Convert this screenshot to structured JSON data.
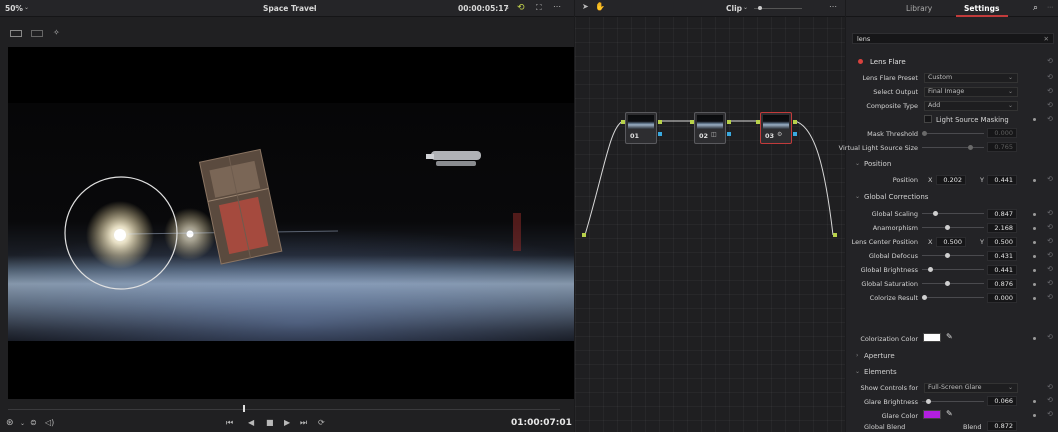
{
  "viewer": {
    "zoom": "50%",
    "title": "Space Travel",
    "timecode": "00:00:05:17",
    "bottom_timecode": "01:00:07:01"
  },
  "node_editor": {
    "mode": "Clip",
    "nodes": [
      {
        "label": "01"
      },
      {
        "label": "02"
      },
      {
        "label": "03"
      }
    ]
  },
  "inspector": {
    "tabs": [
      "Library",
      "Settings"
    ],
    "active_tab": "Settings",
    "search_value": "lens",
    "effect_name": "Lens Flare",
    "rows": {
      "preset_label": "Lens Flare Preset",
      "preset_value": "Custom",
      "output_label": "Select Output",
      "output_value": "Final Image",
      "composite_label": "Composite Type",
      "composite_value": "Add",
      "light_masking": "Light Source Masking",
      "mask_threshold_label": "Mask Threshold",
      "mask_threshold_value": "0.000",
      "vls_label": "Virtual Light Source Size",
      "vls_value": "0.765"
    },
    "position": {
      "header": "Position",
      "label": "Position",
      "x_label": "X",
      "x": "0.202",
      "y_label": "Y",
      "y": "0.441"
    },
    "global_corrections": {
      "header": "Global Corrections",
      "items": [
        {
          "label": "Global Scaling",
          "value": "0.847",
          "level": 0.18
        },
        {
          "label": "Anamorphism",
          "value": "2.168",
          "level": 0.38
        },
        {
          "label": "Global Defocus",
          "value": "0.431",
          "level": 0.38
        },
        {
          "label": "Global Brightness",
          "value": "0.441",
          "level": 0.1
        },
        {
          "label": "Global Saturation",
          "value": "0.876",
          "level": 0.38
        },
        {
          "label": "Colorize Result",
          "value": "0.000",
          "level": 0.0
        }
      ],
      "lcp_label": "Lens Center Position",
      "lcp_x_label": "X",
      "lcp_x": "0.500",
      "lcp_y_label": "Y",
      "lcp_y": "0.500",
      "colorization_label": "Colorization Color",
      "colorization_color": "#ffffff"
    },
    "aperture": {
      "header": "Aperture"
    },
    "elements": {
      "header": "Elements",
      "show_controls_label": "Show Controls for",
      "show_controls_value": "Full-Screen Glare",
      "glare_brightness_label": "Glare Brightness",
      "glare_brightness_value": "0.066",
      "glare_color_label": "Glare Color",
      "glare_color": "#b21fe0"
    },
    "global_blend": {
      "header": "Global Blend",
      "blend_label": "Blend",
      "blend_value": "0.872"
    }
  },
  "colors": {
    "accent_red": "#c23b3b",
    "pin_yellow": "#b8d24a",
    "pin_blue": "#39a9e0",
    "glare_purple": "#b21fe0"
  }
}
